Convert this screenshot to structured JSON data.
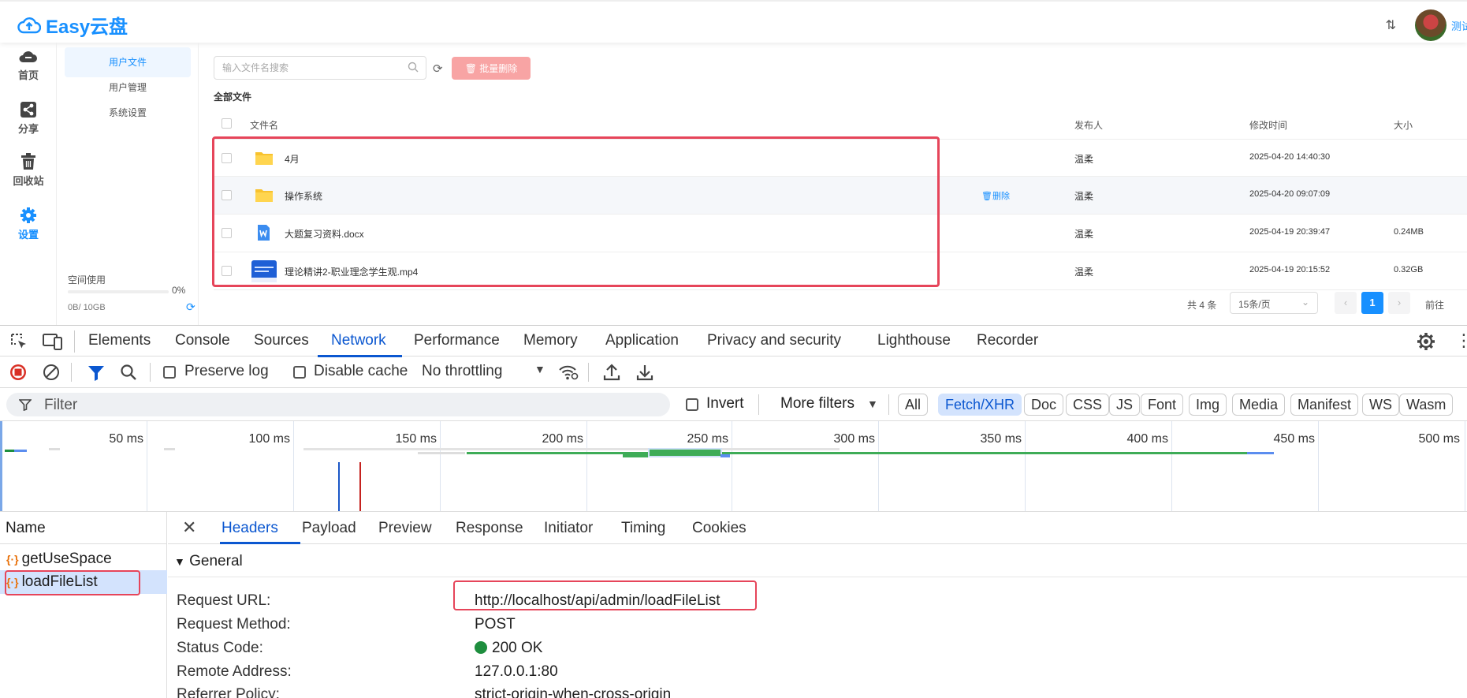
{
  "app": {
    "logo_text": "Easy云盘",
    "user_name": "测试",
    "nav": [
      {
        "label": "首页"
      },
      {
        "label": "分享"
      },
      {
        "label": "回收站"
      },
      {
        "label": "设置"
      }
    ],
    "subnav": [
      {
        "label": "用户文件"
      },
      {
        "label": "用户管理"
      },
      {
        "label": "系统设置"
      }
    ],
    "space": {
      "label": "空间使用",
      "percent_text": "0%",
      "usage_text": "0B/ 10GB",
      "fraction_used": 0
    },
    "search_placeholder": "输入文件名搜索",
    "batch_delete_label": "批量删除",
    "breadcrumb": "全部文件",
    "columns": {
      "name": "文件名",
      "publisher": "发布人",
      "modified": "修改时间",
      "size": "大小"
    },
    "rows": [
      {
        "name": "4月",
        "type": "folder",
        "publisher": "温柔",
        "modified": "2025-04-20 14:40:30",
        "size": ""
      },
      {
        "name": "操作系统",
        "type": "folder",
        "publisher": "温柔",
        "modified": "2025-04-20 09:07:09",
        "size": "",
        "action": "删除"
      },
      {
        "name": "大题复习资料.docx",
        "type": "doc",
        "publisher": "温柔",
        "modified": "2025-04-19 20:39:47",
        "size": "0.24MB"
      },
      {
        "name": "理论精讲2-职业理念学生观.mp4",
        "type": "video",
        "publisher": "温柔",
        "modified": "2025-04-19 20:15:52",
        "size": "0.32GB"
      }
    ],
    "pager": {
      "total": "共 4 条",
      "page_size": "15条/页",
      "current": "1",
      "goto": "前往"
    },
    "colors": {
      "brand": "#1890ff",
      "highlight": "#e6455a"
    }
  },
  "devtools": {
    "tabs": [
      "Elements",
      "Console",
      "Sources",
      "Network",
      "Performance",
      "Memory",
      "Application",
      "Privacy and security",
      "Lighthouse",
      "Recorder"
    ],
    "active_tab": "Network",
    "toolbar": {
      "preserve_log": "Preserve log",
      "disable_cache": "Disable cache",
      "throttling": "No throttling"
    },
    "filter": {
      "placeholder": "Filter",
      "invert": "Invert",
      "more_filters": "More filters"
    },
    "type_filters": [
      "All",
      "Fetch/XHR",
      "Doc",
      "CSS",
      "JS",
      "Font",
      "Img",
      "Media",
      "Manifest",
      "WS",
      "Wasm"
    ],
    "active_type_filter": "Fetch/XHR",
    "timeline_labels": [
      "50 ms",
      "100 ms",
      "150 ms",
      "200 ms",
      "250 ms",
      "300 ms",
      "350 ms",
      "400 ms",
      "450 ms",
      "500 ms"
    ],
    "requests_header": "Name",
    "requests": [
      "getUseSpace",
      "loadFileList"
    ],
    "selected_request": "loadFileList",
    "detail_tabs": [
      "Headers",
      "Payload",
      "Preview",
      "Response",
      "Initiator",
      "Timing",
      "Cookies"
    ],
    "active_detail_tab": "Headers",
    "general_label": "General",
    "general": [
      {
        "key": "Request URL:",
        "value": "http://localhost/api/admin/loadFileList"
      },
      {
        "key": "Request Method:",
        "value": "POST"
      },
      {
        "key": "Status Code:",
        "value": "200 OK"
      },
      {
        "key": "Remote Address:",
        "value": "127.0.0.1:80"
      },
      {
        "key": "Referrer Policy:",
        "value": "strict-origin-when-cross-origin"
      }
    ]
  }
}
